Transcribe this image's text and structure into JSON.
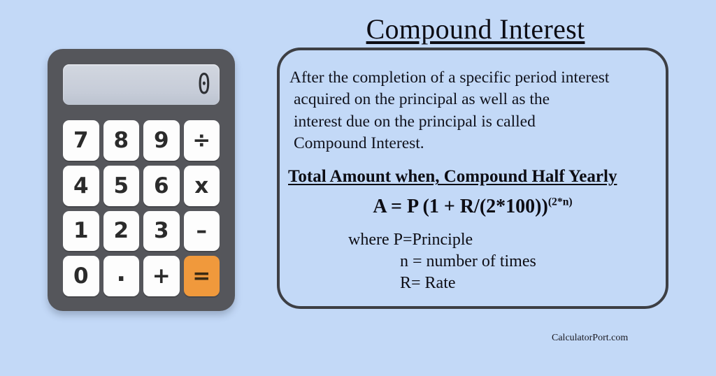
{
  "background_color": "#C3D9F7",
  "title": "Compound Interest",
  "calculator": {
    "body_color": "#55565B",
    "display": {
      "value": "0",
      "panel_color": "#C8CDD8"
    },
    "accent_color": "#F0993C",
    "keys": [
      {
        "label": "7",
        "name": "key-7",
        "accent": false
      },
      {
        "label": "8",
        "name": "key-8",
        "accent": false
      },
      {
        "label": "9",
        "name": "key-9",
        "accent": false
      },
      {
        "label": "÷",
        "name": "key-divide",
        "accent": false
      },
      {
        "label": "4",
        "name": "key-4",
        "accent": false
      },
      {
        "label": "5",
        "name": "key-5",
        "accent": false
      },
      {
        "label": "6",
        "name": "key-6",
        "accent": false
      },
      {
        "label": "x",
        "name": "key-multiply",
        "accent": false
      },
      {
        "label": "1",
        "name": "key-1",
        "accent": false
      },
      {
        "label": "2",
        "name": "key-2",
        "accent": false
      },
      {
        "label": "3",
        "name": "key-3",
        "accent": false
      },
      {
        "label": "–",
        "name": "key-minus",
        "accent": false
      },
      {
        "label": "0",
        "name": "key-0",
        "accent": false
      },
      {
        "label": ".",
        "name": "key-decimal",
        "accent": false
      },
      {
        "label": "+",
        "name": "key-plus",
        "accent": false
      },
      {
        "label": "=",
        "name": "key-equals",
        "accent": true
      }
    ]
  },
  "definition": {
    "line1": "After the completion of a specific period interest",
    "line2": "acquired on the principal as well as the",
    "line3": "interest due on the principal is called",
    "line4": "Compound Interest."
  },
  "subheading": "Total Amount when, Compound Half Yearly",
  "formula": {
    "base": "A = P (1 + R/(2*100))",
    "exponent": "(2*n)"
  },
  "where": {
    "line1": "where P=Principle",
    "line2": "n = number of times",
    "line3": "R= Rate"
  },
  "footer": "CalculatorPort.com"
}
